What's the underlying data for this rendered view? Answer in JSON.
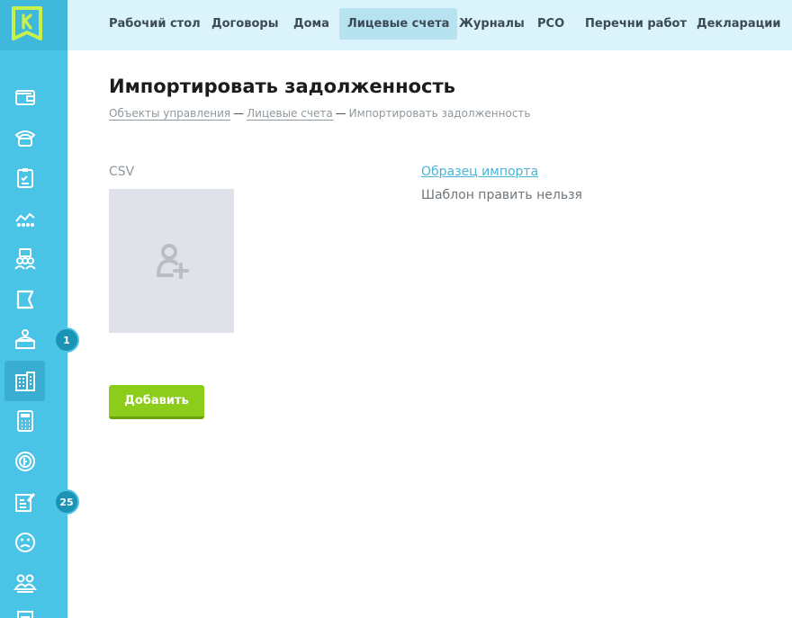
{
  "nav": {
    "items": [
      {
        "label": "Рабочий стол",
        "active": false
      },
      {
        "label": "Договоры",
        "active": false
      },
      {
        "label": "Дома",
        "active": false
      },
      {
        "label": "Лицевые счета",
        "active": true
      },
      {
        "label": "Журналы",
        "active": false
      },
      {
        "label": "РСО",
        "active": false
      },
      {
        "label": "Перечни работ",
        "active": false
      },
      {
        "label": "Декларации",
        "active": false
      }
    ]
  },
  "sidebar": {
    "logo_letter": "K",
    "icons": [
      "wallet-icon",
      "phone-icon",
      "clipboard-icon",
      "analytics-icon",
      "team-icon",
      "flag-icon",
      "dispatcher-icon",
      "building-icon",
      "calculator-icon",
      "coin-icon",
      "edit-note-icon",
      "sad-face-icon",
      "people-icon",
      "document-icon"
    ],
    "badges": {
      "dispatcher": "1",
      "edit_note": "25"
    }
  },
  "page": {
    "title": "Импортировать задолженность",
    "breadcrumb": [
      "Объекты управления",
      "Лицевые счета",
      "Импортировать задолженность"
    ]
  },
  "form": {
    "csv_label": "CSV",
    "sample_link": "Образец импорта",
    "sample_note": "Шаблон править нельзя",
    "add_button": "Добавить"
  },
  "colors": {
    "sidebar": "#4ac4e6",
    "topnav": "#dbf3fa",
    "accent_button": "#8ccc1a",
    "link": "#4ab3d6"
  }
}
